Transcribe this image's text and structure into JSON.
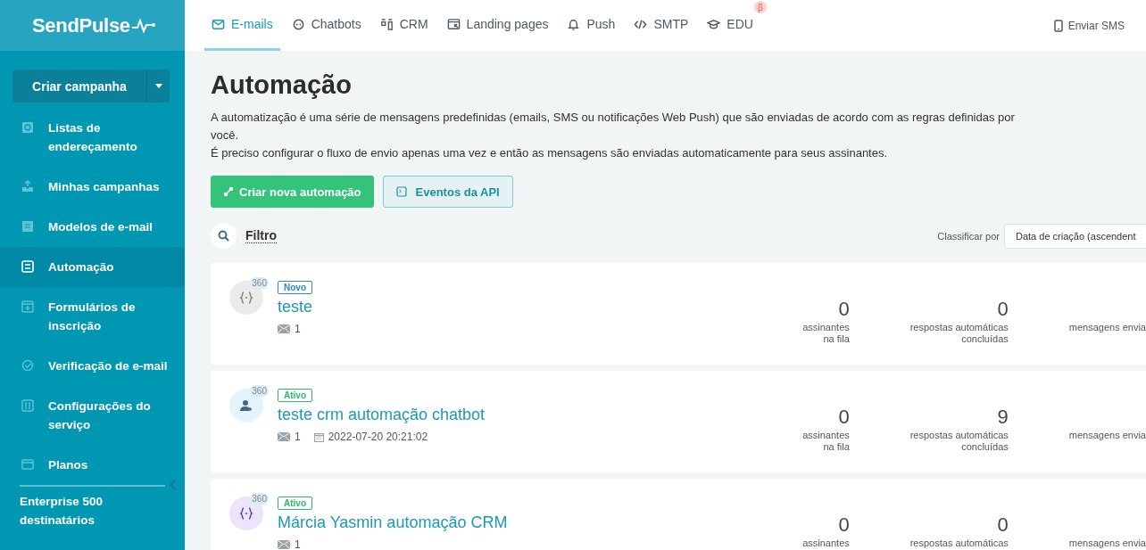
{
  "logo": "SendPulse",
  "tabs": [
    {
      "label": "E-mails",
      "selected": true
    },
    {
      "label": "Chatbots",
      "selected": false
    },
    {
      "label": "CRM",
      "selected": false
    },
    {
      "label": "Landing pages",
      "selected": false
    },
    {
      "label": "Push",
      "selected": false
    },
    {
      "label": "SMTP",
      "selected": false
    },
    {
      "label": "EDU",
      "selected": false,
      "badge": "β"
    }
  ],
  "sms_link": "Enviar SMS",
  "sidebar": {
    "create_button": "Criar campanha",
    "items": [
      {
        "label": "Listas de endereçamento",
        "selected": false
      },
      {
        "label": "Minhas campanhas",
        "selected": false
      },
      {
        "label": "Modelos de e-mail",
        "selected": false
      },
      {
        "label": "Automação",
        "selected": true
      },
      {
        "label": "Formulários de inscrição",
        "selected": false
      },
      {
        "label": "Verificação de e-mail",
        "selected": false
      },
      {
        "label": "Configurações do serviço",
        "selected": false
      },
      {
        "label": "Planos",
        "selected": false
      }
    ],
    "plan": "Enterprise 500 destinatários"
  },
  "page": {
    "title": "Automação",
    "description": [
      "A automatização é uma série de mensagens predefinidas (emails, SMS ou notificações Web Push) que são enviadas de acordo com as regras definidas por você.",
      "É preciso configurar o fluxo de envio apenas uma vez e então as mensagens são enviadas automaticamente para seus assinantes."
    ],
    "primary_button": "Criar nova automação",
    "secondary_button": "Eventos da API",
    "filter": "Filtro",
    "sort_label": "Classificar por",
    "sort_value": "Data de criação (ascendent"
  },
  "automations": [
    {
      "kind": "code",
      "color": "#ebebeb",
      "count_badge": "360",
      "status": {
        "label": "Novo",
        "color": "#2f86c8"
      },
      "name": "teste",
      "emails": "1",
      "metrics": [
        {
          "value": "0",
          "label": [
            "assinantes",
            "na fila"
          ]
        },
        {
          "value": "0",
          "label": [
            "respostas automáticas",
            "concluídas"
          ]
        },
        {
          "label": [
            "mensagens envia"
          ]
        }
      ]
    },
    {
      "kind": "person",
      "color": "#e3f4fd",
      "count_badge": "360",
      "status": {
        "label": "Ativo",
        "color": "#2dbb6a"
      },
      "name": "teste crm automação chatbot",
      "emails": "1",
      "date": "2022-07-20 20:21:02",
      "metrics": [
        {
          "value": "0",
          "label": [
            "assinantes",
            "na fila"
          ]
        },
        {
          "value": "9",
          "label": [
            "respostas automáticas",
            "concluídas"
          ]
        },
        {
          "label": [
            "mensagens envia"
          ]
        }
      ]
    },
    {
      "kind": "code",
      "color": "#ebe4fb",
      "count_badge": "360",
      "status": {
        "label": "Ativo",
        "color": "#2dbb6a"
      },
      "name": "Márcia Yasmin automação CRM",
      "emails": "1",
      "metrics": [
        {
          "value": "0",
          "label": [
            "assinantes"
          ]
        },
        {
          "value": "0",
          "label": [
            "respostas automáticas"
          ]
        },
        {
          "label": [
            "mensagens envia"
          ]
        }
      ]
    }
  ]
}
